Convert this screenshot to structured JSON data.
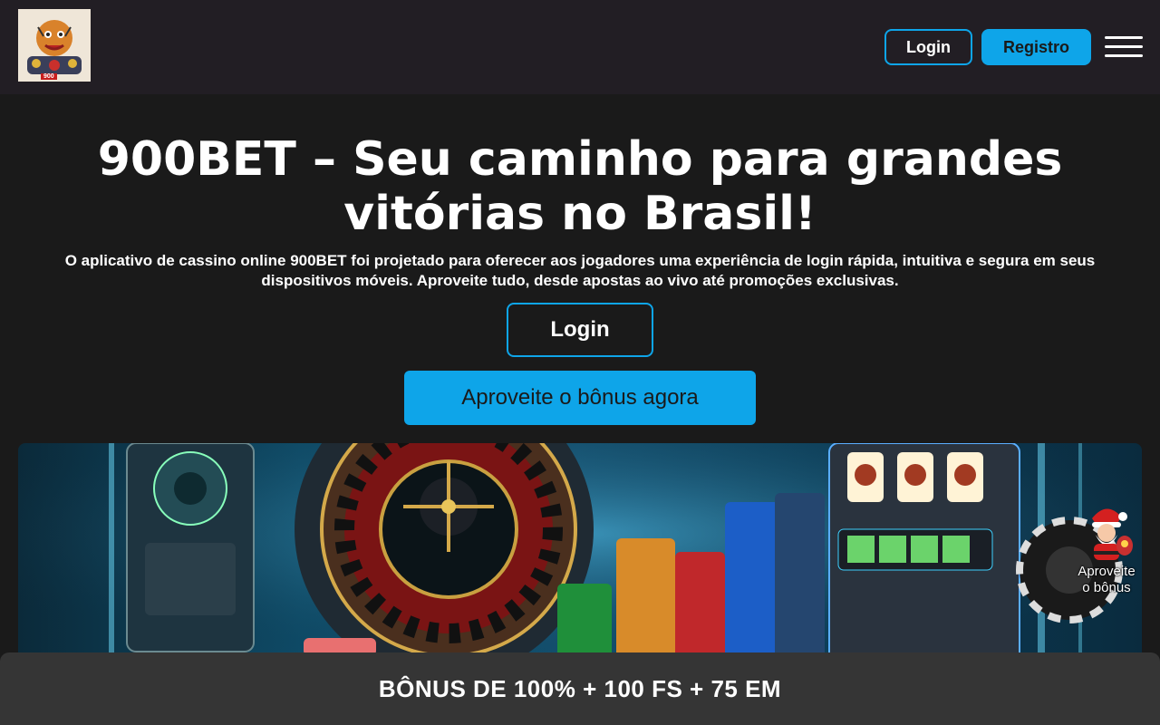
{
  "header": {
    "logo_text": "900",
    "login_label": "Login",
    "register_label": "Registro",
    "menu_icon": "hamburger-menu-icon"
  },
  "hero": {
    "title": "900BET – Seu caminho para grandes vitórias no Brasil!",
    "description": "O aplicativo de cassino online 900BET foi projetado para oferecer aos jogadores uma experiência de login rápida, intuitiva e segura em seus dispositivos móveis. Aproveite tudo, desde apostas ao vivo até promoções exclusivas.",
    "login_label": "Login",
    "bonus_label": "Aproveite o bônus agora"
  },
  "floating_widget": {
    "label_line1": "Aproveite",
    "label_line2": "o bônus",
    "icon": "santa-claus-icon"
  },
  "bottom_bar": {
    "text": "BÔNUS DE 100% + 100 FS + 75 EM"
  },
  "colors": {
    "accent": "#0ea5e9",
    "header_bg": "#221e24",
    "page_bg": "#1a1a1a",
    "bottom_bar_bg": "#353535"
  }
}
